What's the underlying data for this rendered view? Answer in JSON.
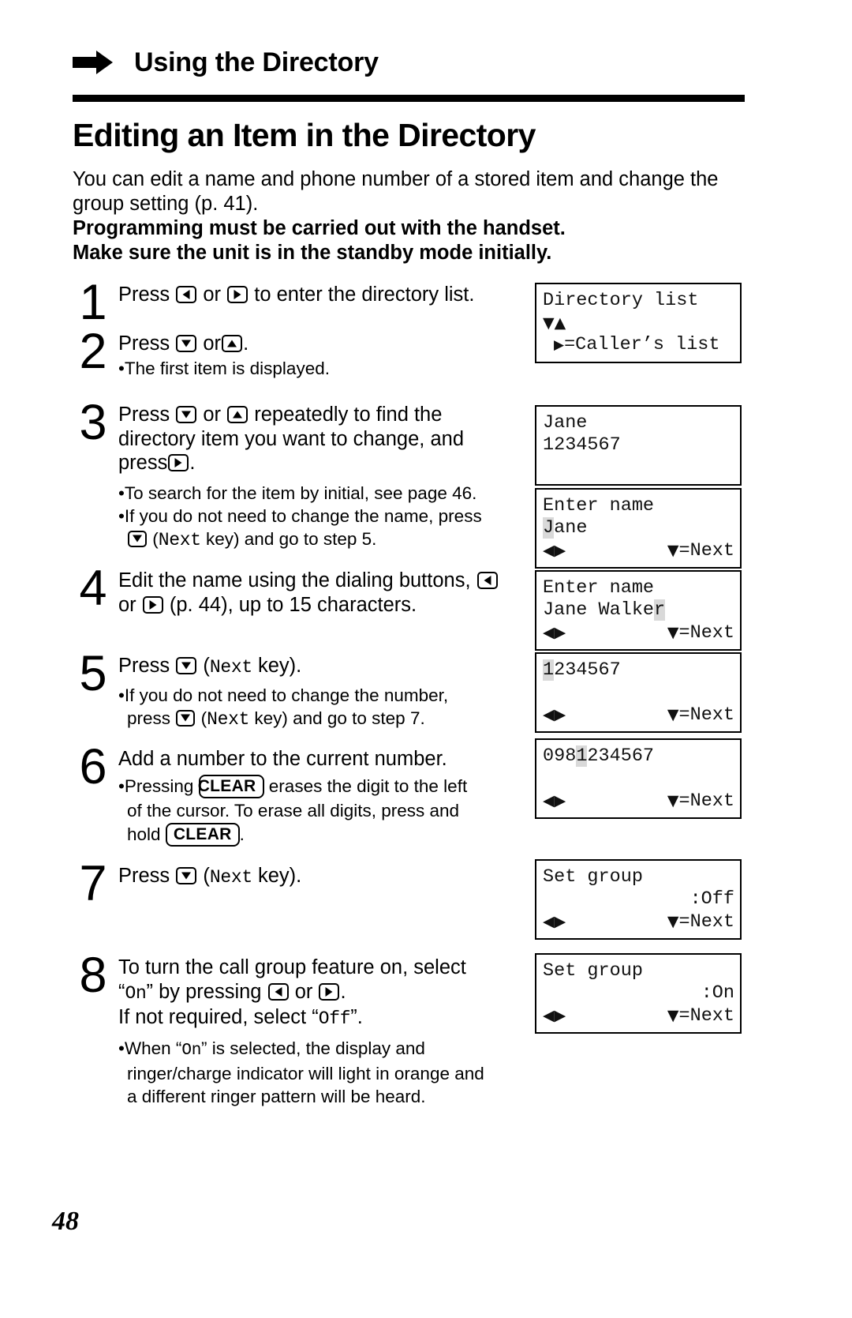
{
  "runhead": {
    "title": "Using the Directory",
    "arrow_icon": "right-arrow-icon"
  },
  "section": {
    "title": "Editing an Item in the Directory"
  },
  "intro": {
    "line1": "You can edit a name and phone number of a stored item and change the",
    "line2": "group setting (p. 41).",
    "bold1": "Programming must be carried out with the handset.",
    "bold2": "Make sure the unit is in the standby mode initially."
  },
  "steps": [
    {
      "num": "1",
      "t1": "Press",
      "key1": "left-arrow-key",
      "t2": "or",
      "key2": "right-arrow-key",
      "t3": "to enter the directory list."
    },
    {
      "num": "2",
      "t1": "Press",
      "key1": "down-arrow-key",
      "t2": "or",
      "key2": "up-arrow-key",
      "t3": ".",
      "sub1": "•The first item is displayed."
    },
    {
      "num": "3",
      "t1": "Press",
      "key1": "down-arrow-key",
      "t2": "or",
      "key2": "up-arrow-key",
      "t3": "repeatedly to find the",
      "t4": "directory item you want to change, and",
      "t5": "press",
      "key3": "right-arrow-key",
      "t6": ".",
      "sub1": "•To search for the item by initial, see page 46.",
      "sub2": "•If you do not need to change the name, press",
      "sub3a": "(",
      "sub3b": "Next",
      "sub3c": " key) and go to step 5."
    },
    {
      "num": "4",
      "t1": "Edit the name using the dialing buttons,",
      "key1": "left-arrow-key",
      "t2": "or",
      "key2": "right-arrow-key",
      "t3": "(p. 44), up to 15 characters."
    },
    {
      "num": "5",
      "t1": "Press",
      "key1": "down-arrow-key",
      "t2a": "(",
      "t2b": "Next",
      "t2c": " key).",
      "sub1": "•If you do not need to change the number,",
      "sub2a": "press",
      "sub2b": "Next",
      "sub2c": " key) and go to step 7."
    },
    {
      "num": "6",
      "t1": "Add a number to the current number.",
      "sub1a": "•Pressing",
      "sub1b": "CLEAR",
      "sub1c": "erases the digit to the left",
      "sub2": "of the cursor. To erase all digits, press and",
      "sub3a": "hold",
      "sub3b": "CLEAR",
      "sub3c": "."
    },
    {
      "num": "7",
      "t1": "Press",
      "key1": "down-arrow-key",
      "t2a": "(",
      "t2b": "Next",
      "t2c": " key)."
    },
    {
      "num": "8",
      "t1": "To turn the call group feature on, select",
      "t2a": "“",
      "t2b": "On",
      "t2c": "” by pressing",
      "key1": "left-arrow-key",
      "t3": "or",
      "key2": "right-arrow-key",
      "t4": ".",
      "t5a": "If not required, select “",
      "t5b": "Off",
      "t5c": "”.",
      "sub1a": "•When “",
      "sub1b": "On",
      "sub1c": "” is selected, the display and",
      "sub2": "ringer/charge indicator will light in orange and",
      "sub3": "a different ringer pattern will be heard."
    }
  ],
  "lcds": [
    {
      "name": "directory-list-display",
      "row1": "Directory list",
      "row2_glyphs": "▼▲",
      "row3_prefix": "▶",
      "row3": "=Caller’s list"
    },
    {
      "name": "directory-item-display",
      "row1": "Jane",
      "row2": "1234567",
      "row3": ""
    },
    {
      "name": "enter-name-display-1",
      "row1": "Enter name",
      "row2_hl": "J",
      "row2_rest": "ane",
      "row3_left": "◀▶",
      "row3_right_glyph": "▼",
      "row3_right": "=Next"
    },
    {
      "name": "enter-name-display-2",
      "row1": "Enter name",
      "row2_pre": "Jane Walke",
      "row2_hl": "r",
      "row3_left": "◀▶",
      "row3_right_glyph": "▼",
      "row3_right": "=Next"
    },
    {
      "name": "enter-number-display-1",
      "row1_hl": "1",
      "row1_rest": "234567",
      "row2": "",
      "row3_left": "◀▶",
      "row3_right_glyph": "▼",
      "row3_right": "=Next"
    },
    {
      "name": "enter-number-display-2",
      "row1_pre": "098",
      "row1_hl": "1",
      "row1_rest": "234567",
      "row2": "",
      "row3_left": "◀▶",
      "row3_right_glyph": "▼",
      "row3_right": "=Next"
    },
    {
      "name": "set-group-off-display",
      "row1": "Set group",
      "row2_right": ":Off",
      "row3_left": "◀▶",
      "row3_right_glyph": "▼",
      "row3_right": "=Next"
    },
    {
      "name": "set-group-on-display",
      "row1": "Set group",
      "row2_right": ":On",
      "row3_left": "◀▶",
      "row3_right_glyph": "▼",
      "row3_right": "=Next"
    }
  ],
  "footer": {
    "page_number": "48"
  }
}
